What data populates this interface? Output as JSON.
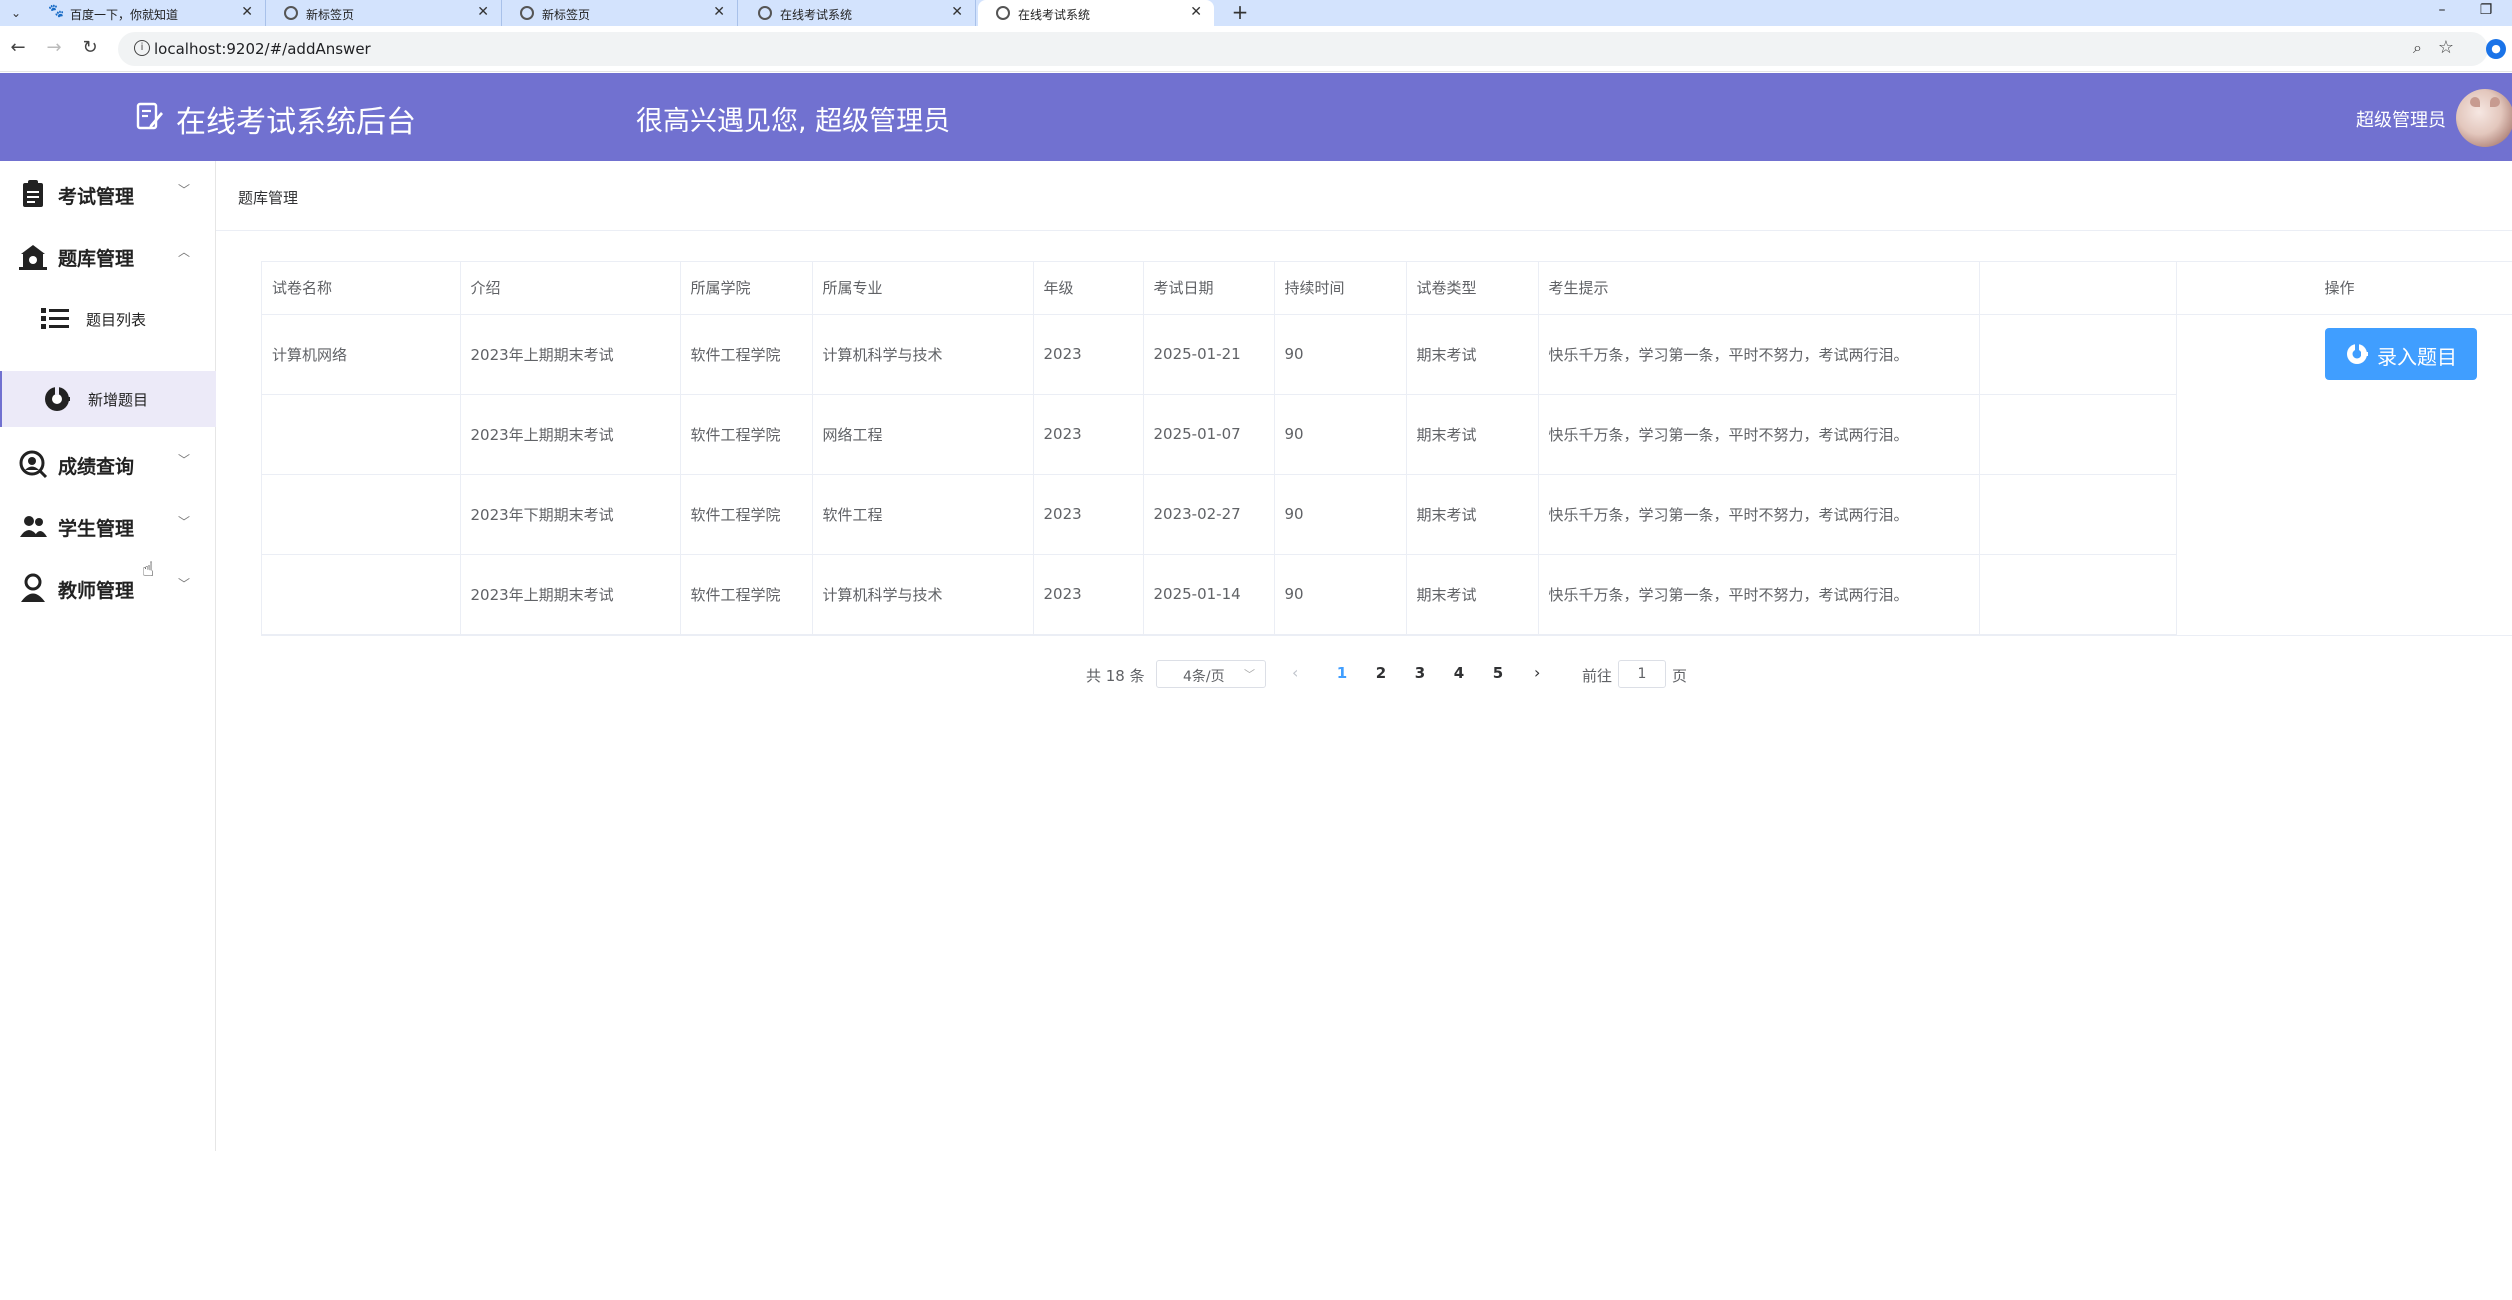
{
  "browser": {
    "tabs": [
      {
        "title": "百度一下，你就知道",
        "icon": "baidu-paw-icon"
      },
      {
        "title": "新标签页",
        "icon": "chrome-icon"
      },
      {
        "title": "新标签页",
        "icon": "chrome-icon"
      },
      {
        "title": "在线考试系统",
        "icon": "globe-icon"
      },
      {
        "title": "在线考试系统",
        "icon": "globe-icon"
      }
    ],
    "url": "localhost:9202/#/addAnswer"
  },
  "header": {
    "title": "在线考试系统后台",
    "welcome": "很高兴遇见您, 超级管理员",
    "user_name": "超级管理员",
    "bg_color": "#7171d0"
  },
  "sidebar": {
    "menus": [
      {
        "label": "考试管理",
        "icon": "exam-clipboard-icon",
        "expanded": false
      },
      {
        "label": "题库管理",
        "icon": "question-bank-icon",
        "expanded": true
      },
      {
        "label": "成绩查询",
        "icon": "score-search-icon",
        "expanded": false
      },
      {
        "label": "学生管理",
        "icon": "students-icon",
        "expanded": false
      },
      {
        "label": "教师管理",
        "icon": "teacher-icon",
        "expanded": false
      }
    ],
    "sub_items": [
      {
        "label": "题目列表",
        "icon": "list-icon",
        "active": false
      },
      {
        "label": "新增题目",
        "icon": "add-question-icon",
        "active": true
      }
    ]
  },
  "breadcrumb": "题库管理",
  "table": {
    "headers": [
      "试卷名称",
      "介绍",
      "所属学院",
      "所属专业",
      "年级",
      "考试日期",
      "持续时间",
      "试卷类型",
      "考生提示",
      "",
      "操作"
    ],
    "rows": [
      [
        "计算机网络",
        "2023年上期期末考试",
        "软件工程学院",
        "计算机科学与技术",
        "2023",
        "2025-01-21",
        "90",
        "期末考试",
        "快乐千万条，学习第一条，平时不努力，考试两行泪。"
      ],
      [
        "",
        "2023年上期期末考试",
        "软件工程学院",
        "网络工程",
        "2023",
        "2025-01-07",
        "90",
        "期末考试",
        "快乐千万条，学习第一条，平时不努力，考试两行泪。"
      ],
      [
        "",
        "2023年下期期末考试",
        "软件工程学院",
        "软件工程",
        "2023",
        "2023-02-27",
        "90",
        "期末考试",
        "快乐千万条，学习第一条，平时不努力，考试两行泪。"
      ],
      [
        "",
        "2023年上期期末考试",
        "软件工程学院",
        "计算机科学与技术",
        "2023",
        "2025-01-14",
        "90",
        "期末考试",
        "快乐千万条，学习第一条，平时不努力，考试两行泪。"
      ]
    ],
    "action_label": "录入题目",
    "action_color": "#409eff"
  },
  "pagination": {
    "total": "共 18 条",
    "page_size": "4条/页",
    "pages": [
      "1",
      "2",
      "3",
      "4",
      "5"
    ],
    "current": "1",
    "goto_prefix": "前往",
    "goto_value": "1",
    "goto_suffix": "页"
  }
}
